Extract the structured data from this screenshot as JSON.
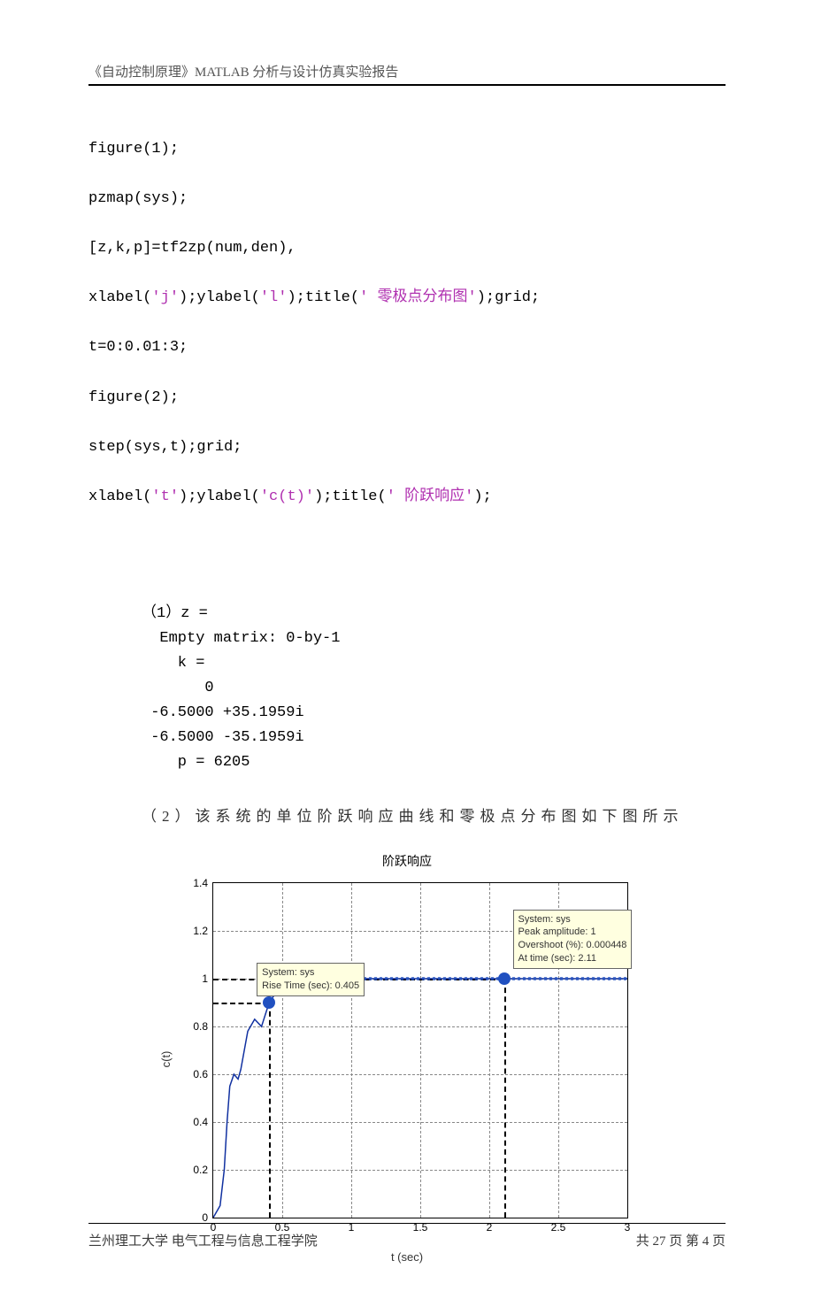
{
  "header": "《自动控制原理》MATLAB 分析与设计仿真实验报告",
  "code": {
    "l1": "figure(1);",
    "l2": "pzmap(sys);",
    "l3": "[z,k,p]=tf2zp(num,den),",
    "l4a": "xlabel(",
    "l4s1": "'j'",
    "l4b": ");ylabel(",
    "l4s2": "'l'",
    "l4c": ");title(",
    "l4s3": "' 零极点分布图'",
    "l4d": ");grid;",
    "l5": "t=0:0.01:3;",
    "l6": "figure(2);",
    "l7": "step(sys,t);grid;",
    "l8a": "xlabel(",
    "l8s1": "'t'",
    "l8b": ");ylabel(",
    "l8s2": "'c(t)'",
    "l8c": ");title(",
    "l8s3": "' 阶跃响应'",
    "l8d": ");"
  },
  "result": {
    "r1": "（1）z =",
    "r2": "  Empty matrix: 0-by-1",
    "r3": "    k =",
    "r4": "       0",
    "r5": " -6.5000 +35.1959i",
    "r6": " -6.5000 -35.1959i",
    "r7": "    p = 6205"
  },
  "desc2": "（2）该系统的单位阶跃响应曲线和零极点分布图如下图所示",
  "chart_data": {
    "type": "line",
    "title": "阶跃响应",
    "xlabel": "t (sec)",
    "ylabel": "c(t)",
    "xlim": [
      0,
      3
    ],
    "ylim": [
      0,
      1.4
    ],
    "xticks": [
      0,
      0.5,
      1,
      1.5,
      2,
      2.5,
      3
    ],
    "yticks": [
      0,
      0.2,
      0.4,
      0.6,
      0.8,
      1,
      1.2,
      1.4
    ],
    "series": [
      {
        "name": "sys",
        "x": [
          0,
          0.05,
          0.08,
          0.1,
          0.12,
          0.15,
          0.18,
          0.2,
          0.25,
          0.3,
          0.35,
          0.405,
          0.5,
          0.7,
          1.0,
          1.5,
          2.0,
          2.11,
          2.5,
          3.0
        ],
        "y": [
          0,
          0.05,
          0.2,
          0.4,
          0.55,
          0.6,
          0.58,
          0.62,
          0.78,
          0.83,
          0.8,
          0.9,
          0.98,
          1.0,
          1.0,
          1.0,
          1.0,
          1.0000045,
          1.0,
          1.0
        ]
      }
    ],
    "markers": [
      {
        "t": 0.405,
        "y": 0.9,
        "tip": [
          "System: sys",
          "Rise Time (sec): 0.405"
        ]
      },
      {
        "t": 2.11,
        "y": 1.0,
        "tip": [
          "System: sys",
          "Peak amplitude: 1",
          "Overshoot (%): 0.000448",
          "At time (sec): 2.11"
        ]
      }
    ]
  },
  "footer": {
    "left": "兰州理工大学   电气工程与信息工程学院",
    "right": "共 27 页   第 4 页"
  }
}
